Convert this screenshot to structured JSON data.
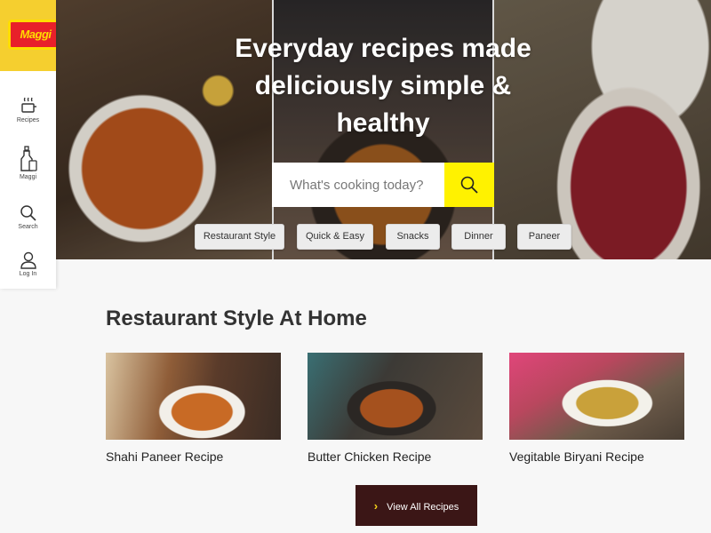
{
  "brand": {
    "logo_text": "Maggi",
    "logo_bg": "#f5cf2f",
    "logo_red": "#e8202a"
  },
  "sidebar": {
    "items": [
      {
        "icon": "recipes-icon",
        "label": "Recipes"
      },
      {
        "icon": "maggi-bottle-icon",
        "label": "Maggi"
      },
      {
        "icon": "search-icon",
        "label": "Search"
      },
      {
        "icon": "user-icon",
        "label": "Log In"
      }
    ]
  },
  "hero": {
    "title": "Everyday recipes made deliciously simple & healthy",
    "search_placeholder": "What's cooking today?",
    "search_button_icon": "search-icon",
    "accent": "#fff200",
    "chips": [
      "Restaurant Style",
      "Quick & Easy",
      "Snacks",
      "Dinner",
      "Paneer"
    ]
  },
  "section": {
    "title": "Restaurant Style At Home",
    "cards": [
      {
        "title": "Shahi Paneer Recipe"
      },
      {
        "title": "Butter Chicken Recipe"
      },
      {
        "title": "Vegitable Biryani Recipe"
      }
    ],
    "view_all_label": "View All Recipes",
    "view_all_bg": "#3b1616"
  }
}
